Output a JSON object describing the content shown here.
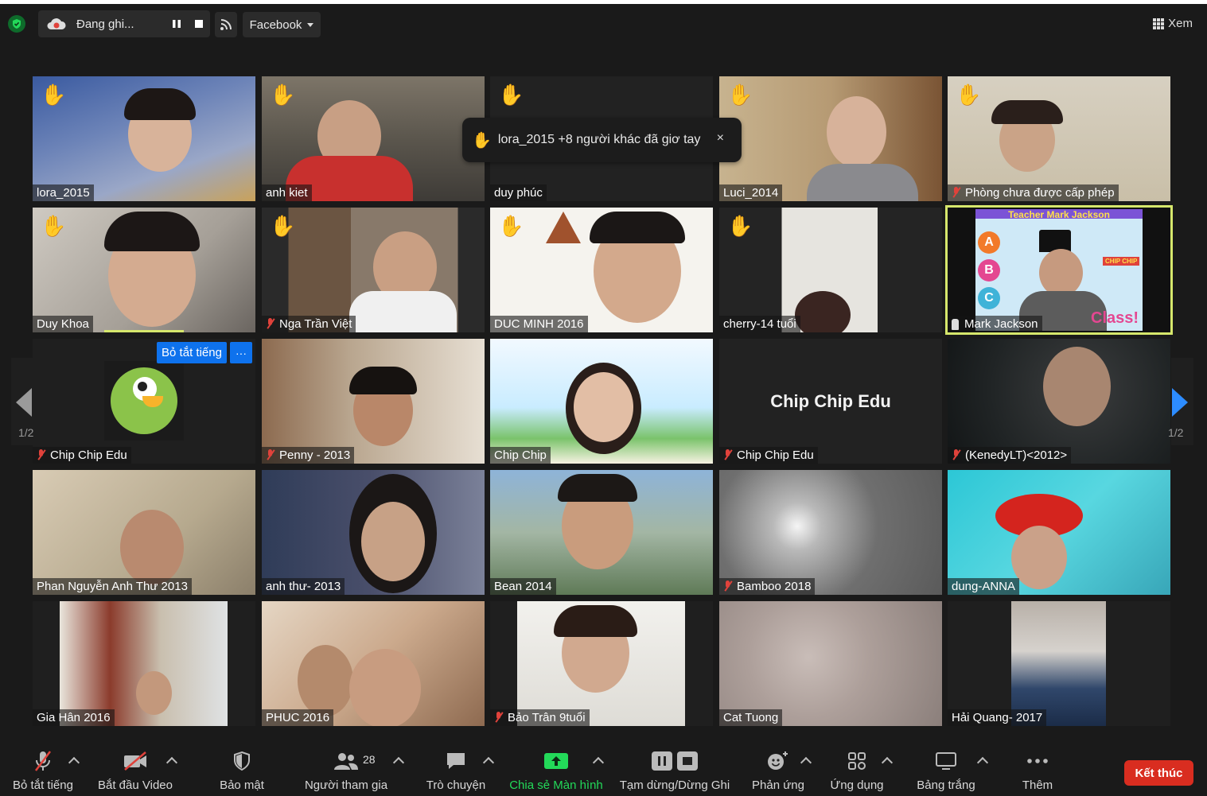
{
  "recording": {
    "status": "Đang ghi..."
  },
  "stream": {
    "target": "Facebook"
  },
  "view": {
    "label": "Xem"
  },
  "toast": {
    "message": "lora_2015 +8 người khác đã giơ tay",
    "close": "×"
  },
  "tile_controls": {
    "unmute": "Bỏ tắt tiếng",
    "more": "···"
  },
  "pagination": {
    "left": "1/2",
    "right": "1/2"
  },
  "participants": [
    {
      "name": "lora_2015",
      "hand": true,
      "muted": false
    },
    {
      "name": "anh kiet",
      "hand": true,
      "muted": false
    },
    {
      "name": "duy phúc",
      "hand": true,
      "muted": false
    },
    {
      "name": "Luci_2014",
      "hand": true,
      "muted": false
    },
    {
      "name": "Phòng chưa được cấp phép",
      "hand": true,
      "muted": true
    },
    {
      "name": "Duy Khoa",
      "hand": true,
      "muted": false
    },
    {
      "name": "Nga Trần Việt",
      "hand": true,
      "muted": true
    },
    {
      "name": "DUC MINH 2016",
      "hand": true,
      "muted": false
    },
    {
      "name": "cherry-14 tuổi",
      "hand": true,
      "muted": false
    },
    {
      "name": "Mark Jackson",
      "hand": false,
      "muted": false,
      "host": true,
      "banner": "Teacher Mark Jackson",
      "logo": "CHIP CHIP",
      "letters": [
        "A",
        "B",
        "C"
      ],
      "overlay": "Class!"
    },
    {
      "name": "Chip Chip Edu",
      "hand": false,
      "muted": true
    },
    {
      "name": "Penny - 2013",
      "hand": false,
      "muted": true
    },
    {
      "name": "Chip Chip",
      "hand": false,
      "muted": false
    },
    {
      "name": "Chip Chip Edu",
      "hand": false,
      "muted": true,
      "center_text": "Chip Chip Edu"
    },
    {
      "name": "(KenedyLT)<2012>",
      "hand": false,
      "muted": true
    },
    {
      "name": "Phan Nguyễn Anh Thư 2013",
      "hand": false,
      "muted": false
    },
    {
      "name": "anh thư- 2013",
      "hand": false,
      "muted": false
    },
    {
      "name": "Bean 2014",
      "hand": false,
      "muted": false
    },
    {
      "name": "Bamboo 2018",
      "hand": false,
      "muted": true
    },
    {
      "name": "dung-ANNA",
      "hand": false,
      "muted": false
    },
    {
      "name": "Gia Hân 2016",
      "hand": false,
      "muted": false
    },
    {
      "name": "PHUC 2016",
      "hand": false,
      "muted": false
    },
    {
      "name": "Bảo Trân 9tuổi",
      "hand": false,
      "muted": true
    },
    {
      "name": "Cat Tuong",
      "hand": false,
      "muted": false
    },
    {
      "name": "Hải Quang- 2017",
      "hand": false,
      "muted": false
    }
  ],
  "toolbar": {
    "mute": "Bỏ tắt tiếng",
    "video": "Bắt đầu Video",
    "security": "Bảo mật",
    "participants": "Người tham gia",
    "participants_count": "28",
    "chat": "Trò chuyện",
    "share": "Chia sẻ Màn hình",
    "record": "Tạm dừng/Dừng Ghi",
    "reactions": "Phản ứng",
    "apps": "Ứng dụng",
    "whiteboard": "Bảng trắng",
    "more": "Thêm",
    "end": "Kết thúc"
  },
  "colors": {
    "hand": "#f1b31c",
    "accent": "#0e72ed",
    "end": "#d92d20",
    "share": "#23d959",
    "active_speaker": "#d6e76c"
  }
}
